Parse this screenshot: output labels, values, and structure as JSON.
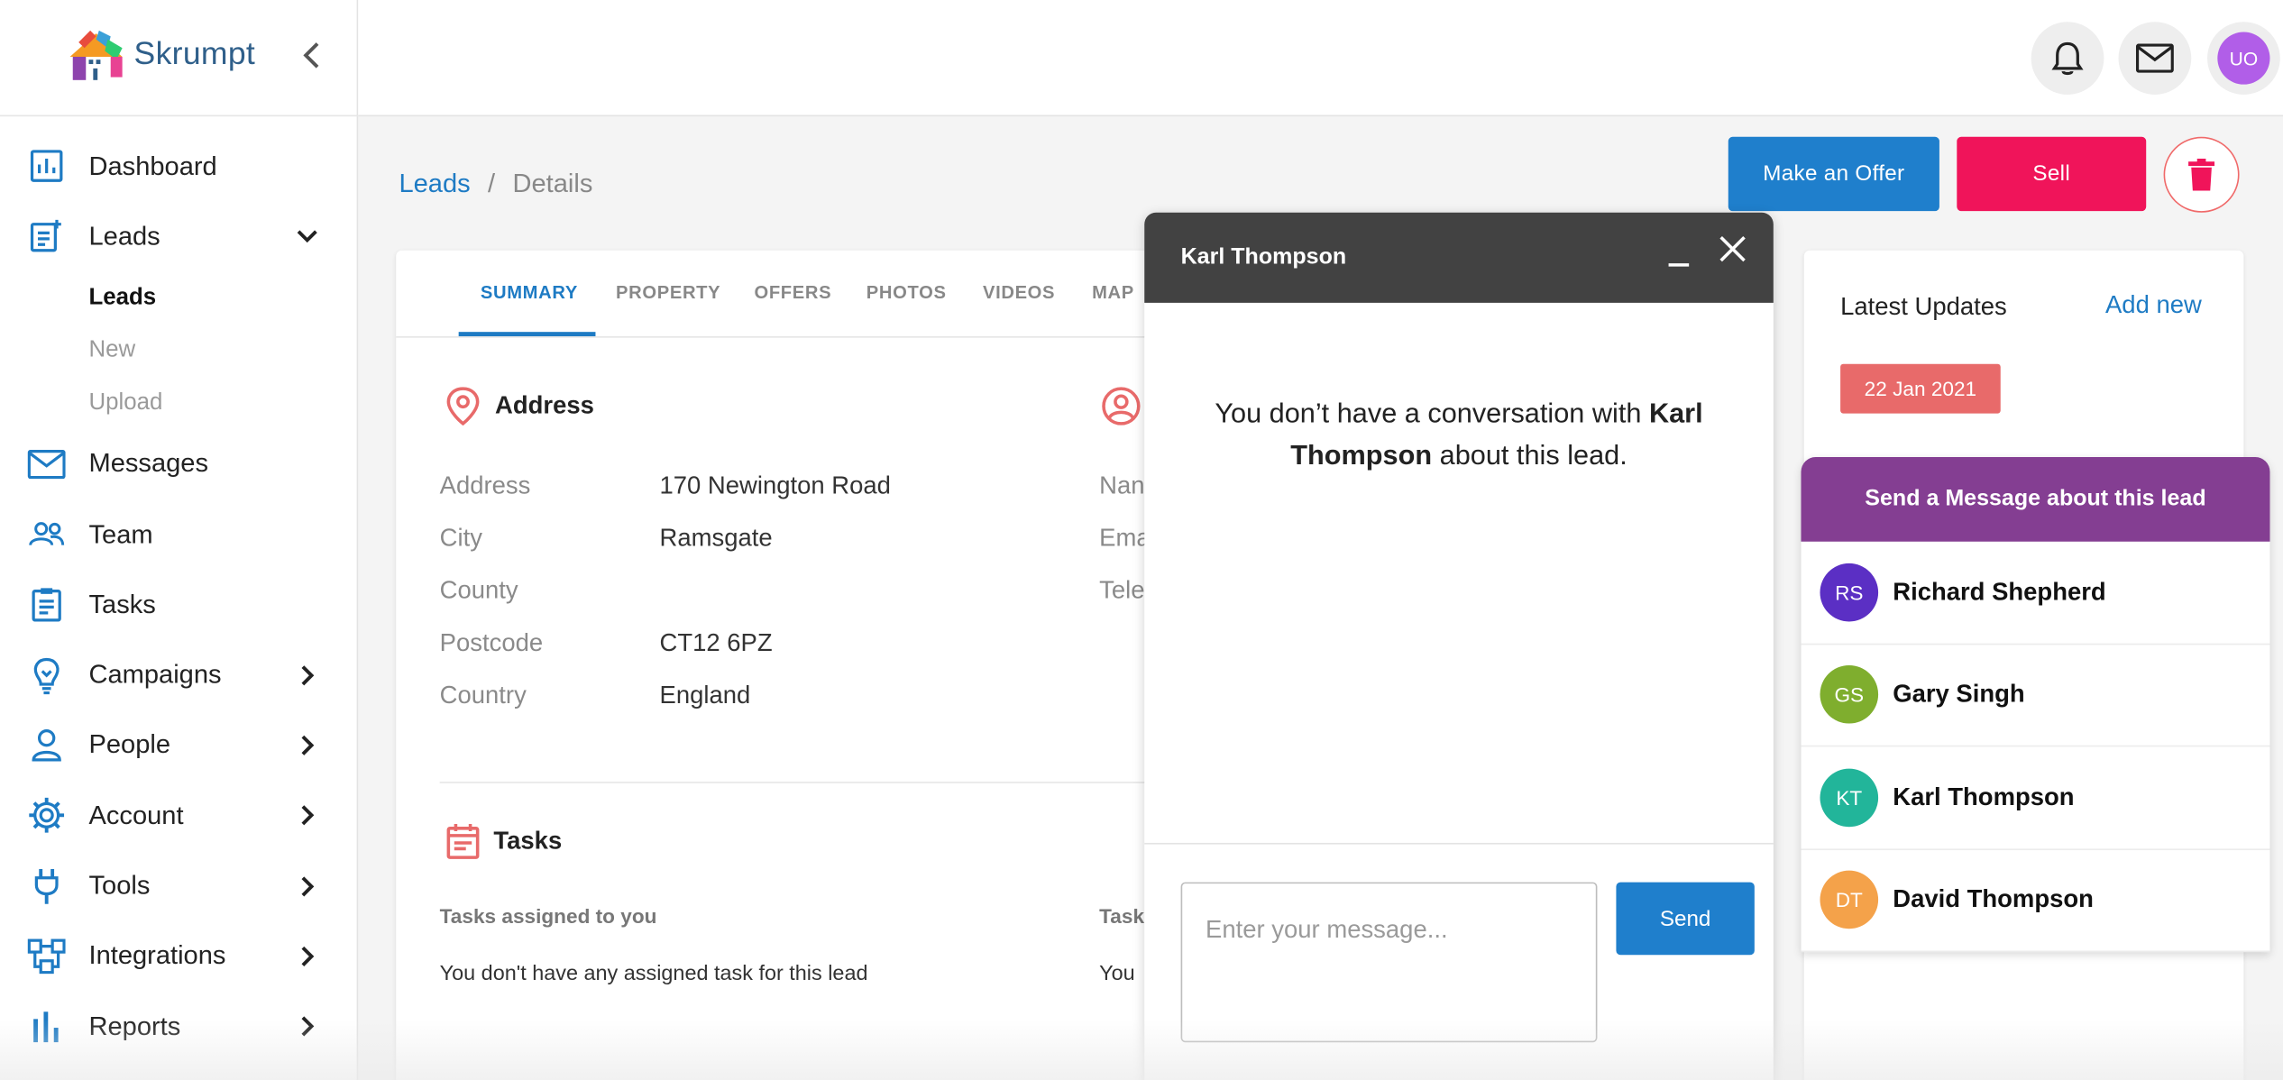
{
  "app": {
    "name": "Skrumpt"
  },
  "sidebar": {
    "items": [
      {
        "label": "Dashboard",
        "icon": "dashboard-icon"
      },
      {
        "label": "Leads",
        "icon": "leads-icon",
        "expanded": true
      },
      {
        "label": "Messages",
        "icon": "mail-icon"
      },
      {
        "label": "Team",
        "icon": "team-icon"
      },
      {
        "label": "Tasks",
        "icon": "clipboard-icon"
      },
      {
        "label": "Campaigns",
        "icon": "lightbulb-icon"
      },
      {
        "label": "People",
        "icon": "person-icon"
      },
      {
        "label": "Account",
        "icon": "gear-icon"
      },
      {
        "label": "Tools",
        "icon": "plug-icon"
      },
      {
        "label": "Integrations",
        "icon": "integrations-icon"
      },
      {
        "label": "Reports",
        "icon": "bar-chart-icon"
      }
    ],
    "leads_sub": [
      {
        "label": "Leads",
        "active": true
      },
      {
        "label": "New",
        "active": false
      },
      {
        "label": "Upload",
        "active": false
      }
    ]
  },
  "topbar": {
    "avatar_initials": "UO"
  },
  "breadcrumb": {
    "root": "Leads",
    "sep": "/",
    "current": "Details"
  },
  "actions": {
    "offer": "Make an Offer",
    "sell": "Sell"
  },
  "tabs": [
    "SUMMARY",
    "PROPERTY",
    "OFFERS",
    "PHOTOS",
    "VIDEOS",
    "MAP"
  ],
  "address": {
    "title": "Address",
    "rows": [
      {
        "k": "Address",
        "v": "170 Newington Road"
      },
      {
        "k": "City",
        "v": "Ramsgate"
      },
      {
        "k": "County",
        "v": ""
      },
      {
        "k": "Postcode",
        "v": "CT12 6PZ"
      },
      {
        "k": "Country",
        "v": "England"
      }
    ]
  },
  "contact_partial": {
    "rows": [
      "Nan",
      "Ema",
      "Tele"
    ]
  },
  "tasks": {
    "title": "Tasks",
    "assigned_label": "Tasks assigned to you",
    "assigned_empty": "You don't have any assigned task for this lead",
    "other_label": "Task",
    "other_empty": "You"
  },
  "updates": {
    "title": "Latest Updates",
    "add": "Add new",
    "date": "22 Jan 2021"
  },
  "message_panel": {
    "title": "Send a Message about this lead",
    "contacts": [
      {
        "initials": "RS",
        "name": "Richard Shepherd",
        "color": "#5b2fc4"
      },
      {
        "initials": "GS",
        "name": "Gary Singh",
        "color": "#7fae2e"
      },
      {
        "initials": "KT",
        "name": "Karl Thompson",
        "color": "#22b59a"
      },
      {
        "initials": "DT",
        "name": "David Thompson",
        "color": "#f4a24a"
      }
    ]
  },
  "chat": {
    "title": "Karl Thompson",
    "msg_pre": "You don’t have a conversation with ",
    "msg_name": "Karl Thompson",
    "msg_post": " about this lead.",
    "placeholder": "Enter your message...",
    "send": "Send"
  },
  "colors": {
    "accent": "#1f7fcc",
    "sell": "#f0145a",
    "purple": "#843e92",
    "date_badge": "#e86a6a"
  }
}
